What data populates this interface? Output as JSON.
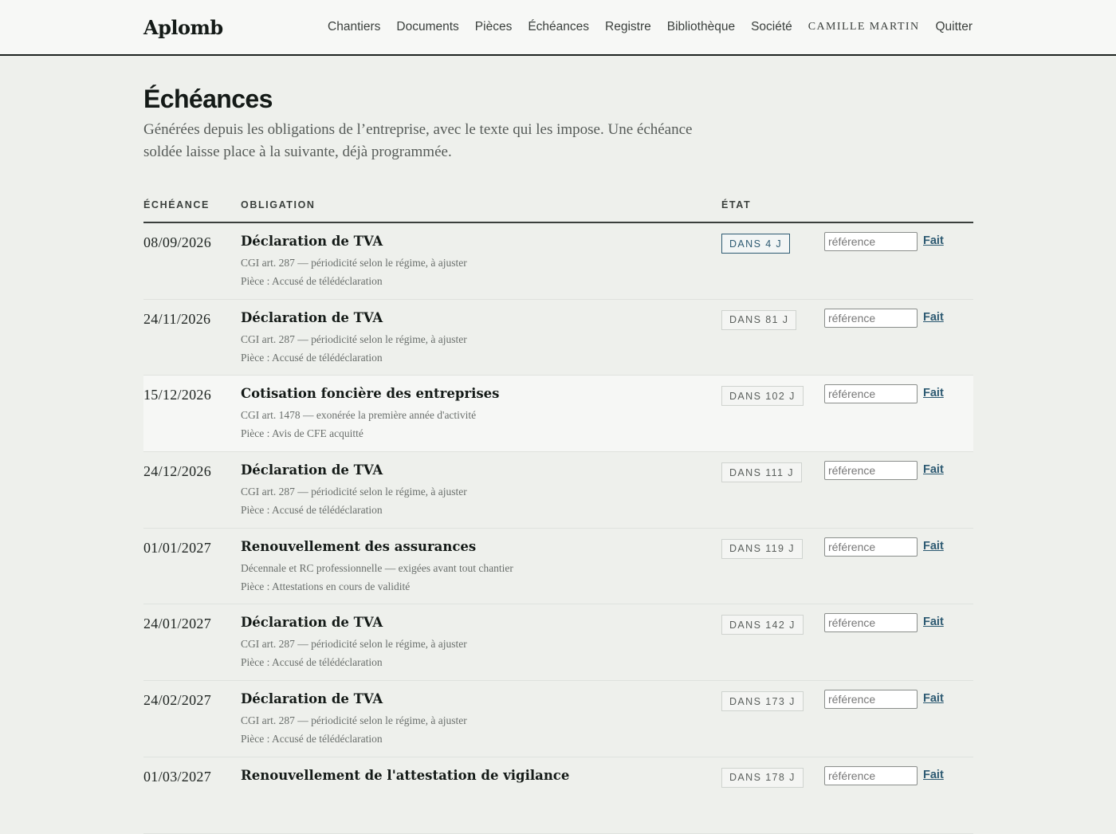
{
  "header": {
    "logo": "Aplomb",
    "nav": [
      "Chantiers",
      "Documents",
      "Pièces",
      "Échéances",
      "Registre",
      "Bibliothèque",
      "Société"
    ],
    "user": "Camille Martin",
    "logout": "Quitter"
  },
  "page": {
    "title": "Échéances",
    "intro": "Générées depuis les obligations de l’entreprise, avec le texte qui les impose. Une échéance soldée laisse place à la suivante, déjà programmée."
  },
  "table": {
    "headers": {
      "date": "Échéance",
      "obligation": "Obligation",
      "state": "État"
    },
    "input_placeholder": "référence",
    "done_label": "Fait",
    "rows": [
      {
        "date": "08/09/2026",
        "title": "Déclaration de TVA",
        "legal": "CGI art. 287 — périodicité selon le régime, à ajuster",
        "piece": "Pièce : Accusé de télédéclaration",
        "state": "DANS 4 J",
        "urgent": true
      },
      {
        "date": "24/11/2026",
        "title": "Déclaration de TVA",
        "legal": "CGI art. 287 — périodicité selon le régime, à ajuster",
        "piece": "Pièce : Accusé de télédéclaration",
        "state": "DANS 81 J"
      },
      {
        "date": "15/12/2026",
        "title": "Cotisation foncière des entreprises",
        "legal": "CGI art. 1478 — exonérée la première année d'activité",
        "piece": "Pièce : Avis de CFE acquitté",
        "state": "DANS 102 J",
        "highlight": true
      },
      {
        "date": "24/12/2026",
        "title": "Déclaration de TVA",
        "legal": "CGI art. 287 — périodicité selon le régime, à ajuster",
        "piece": "Pièce : Accusé de télédéclaration",
        "state": "DANS 111 J"
      },
      {
        "date": "01/01/2027",
        "title": "Renouvellement des assurances",
        "legal": "Décennale et RC professionnelle — exigées avant tout chantier",
        "piece": "Pièce : Attestations en cours de validité",
        "state": "DANS 119 J"
      },
      {
        "date": "24/01/2027",
        "title": "Déclaration de TVA",
        "legal": "CGI art. 287 — périodicité selon le régime, à ajuster",
        "piece": "Pièce : Accusé de télédéclaration",
        "state": "DANS 142 J"
      },
      {
        "date": "24/02/2027",
        "title": "Déclaration de TVA",
        "legal": "CGI art. 287 — périodicité selon le régime, à ajuster",
        "piece": "Pièce : Accusé de télédéclaration",
        "state": "DANS 173 J"
      },
      {
        "date": "01/03/2027",
        "title": "Renouvellement de l'attestation de vigilance",
        "legal": "",
        "piece": "",
        "state": "DANS 178 J"
      }
    ]
  }
}
